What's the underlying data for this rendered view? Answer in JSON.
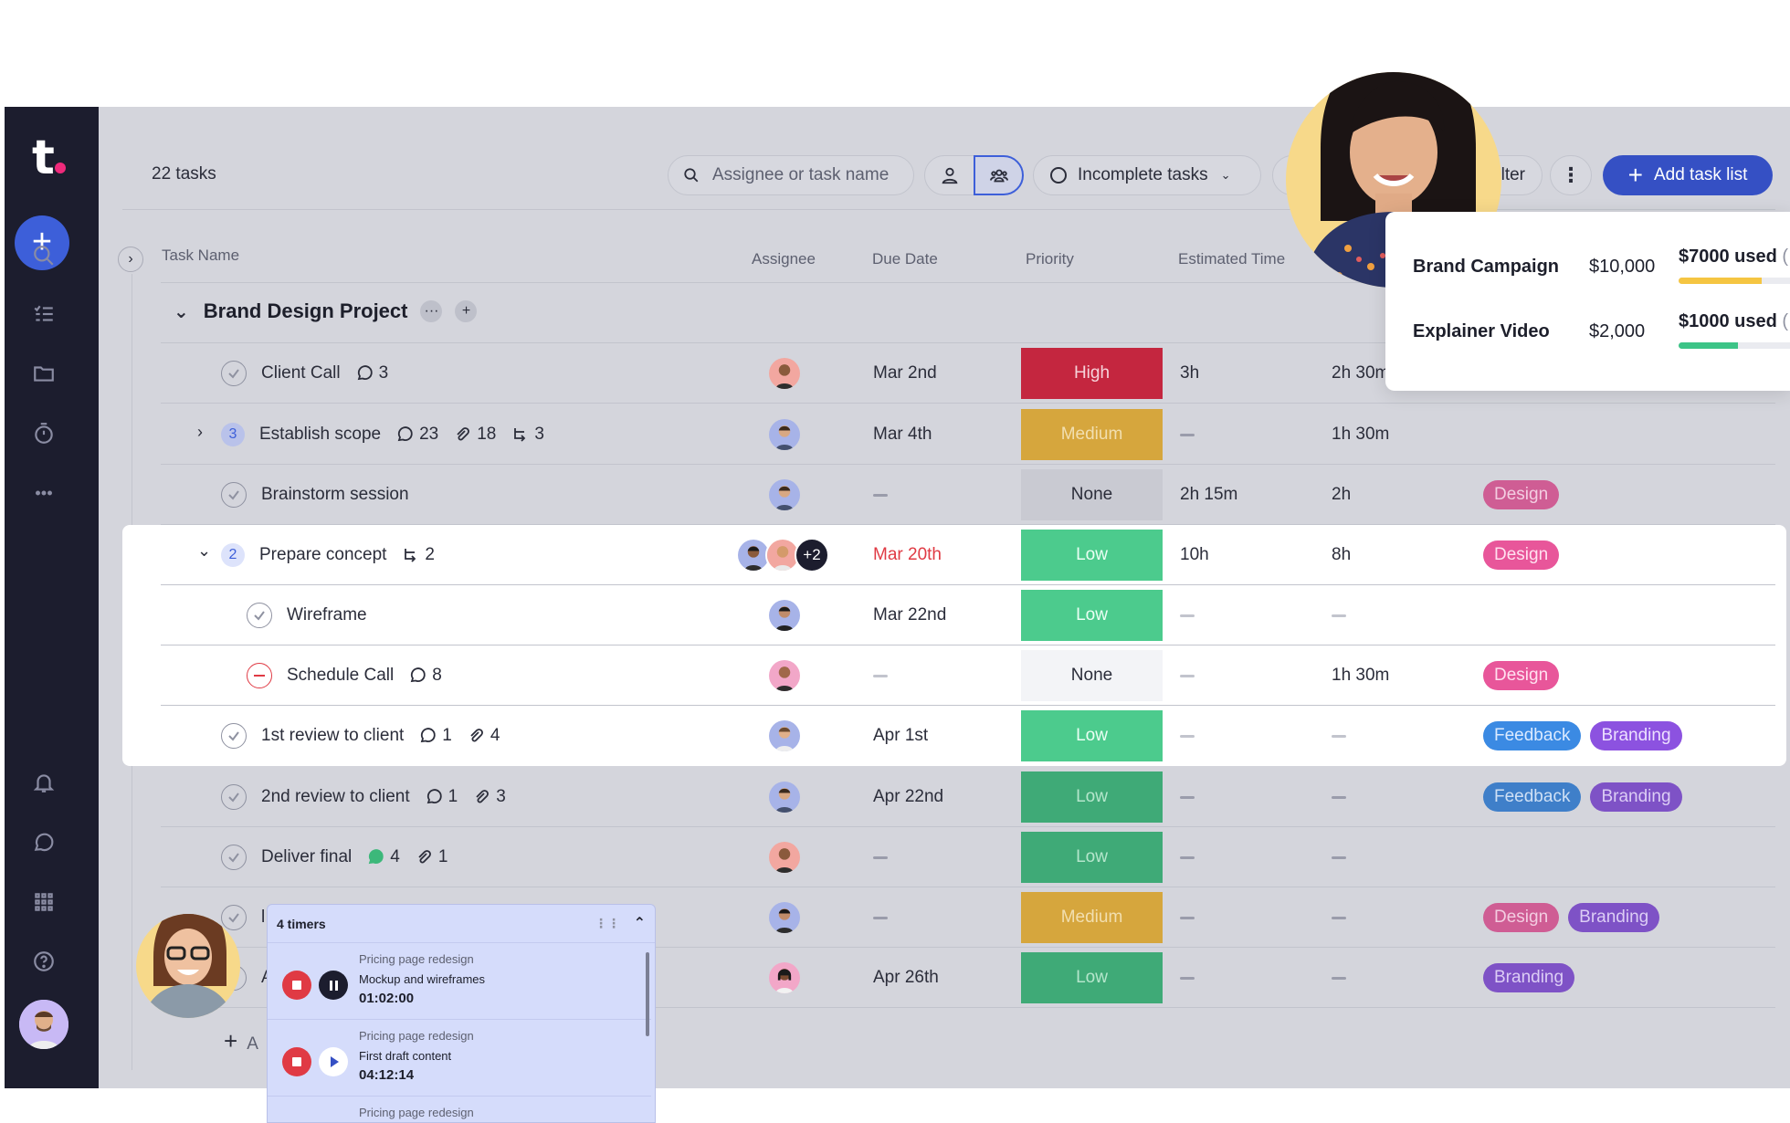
{
  "app": {
    "logo_letter": "t"
  },
  "header": {
    "tasks_count": "22 tasks",
    "search_placeholder": "Assignee or task name",
    "filter_select": "Incomplete tasks",
    "filter_label": "lter",
    "add_task_list": "Add task list"
  },
  "columns": {
    "task_name": "Task Name",
    "assignee": "Assignee",
    "due_date": "Due Date",
    "priority": "Priority",
    "estimated_time": "Estimated Time"
  },
  "group": {
    "title": "Brand Design Project"
  },
  "rows": [
    {
      "name": "Client Call",
      "comments": "3",
      "due": "Mar 2nd",
      "priority": "High",
      "est": "3h",
      "time": "2h 30m"
    },
    {
      "name": "Establish scope",
      "subtasks_count": "3",
      "comments": "23",
      "attachments": "18",
      "subs": "3",
      "due": "Mar 4th",
      "priority": "Medium",
      "time": "1h 30m"
    },
    {
      "name": "Brainstorm session",
      "priority": "None",
      "est": "2h 15m",
      "time": "2h",
      "tags": [
        "Design"
      ]
    },
    {
      "name": "Prepare concept",
      "subtasks_count": "2",
      "subs": "2",
      "extra_assignees": "+2",
      "due": "Mar 20th",
      "priority": "Low",
      "est": "10h",
      "time": "8h",
      "tags": [
        "Design"
      ]
    },
    {
      "name": "Wireframe",
      "due": "Mar 22nd",
      "priority": "Low"
    },
    {
      "name": "Schedule Call",
      "comments": "8",
      "priority": "None",
      "time": "1h 30m",
      "tags": [
        "Design"
      ]
    },
    {
      "name": "1st review to client",
      "comments": "1",
      "attachments": "4",
      "due": "Apr 1st",
      "priority": "Low",
      "tags": [
        "Feedback",
        "Branding"
      ]
    },
    {
      "name": "2nd review to client",
      "comments": "1",
      "attachments": "3",
      "due": "Apr 22nd",
      "priority": "Low",
      "tags": [
        "Feedback",
        "Branding"
      ]
    },
    {
      "name": "Deliver final",
      "comments": "4",
      "attachments": "1",
      "priority": "Low"
    },
    {
      "name": "l",
      "priority": "Medium",
      "tags": [
        "Design",
        "Branding"
      ]
    },
    {
      "name": "A",
      "due": "Apr 26th",
      "priority": "Low",
      "tags": [
        "Branding"
      ]
    }
  ],
  "add_task": {
    "label": "A"
  },
  "budget": [
    {
      "name": "Brand Campaign",
      "amount": "$10,000",
      "used": "$7000 used",
      "used_suffix": "(",
      "fraction": 0.7,
      "color": "#f5c542"
    },
    {
      "name": "Explainer Video",
      "amount": "$2,000",
      "used": "$1000 used",
      "used_suffix": "(",
      "fraction": 0.5,
      "color": "#3cc487"
    }
  ],
  "timers": {
    "title": "4 timers",
    "items": [
      {
        "project": "Pricing page redesign",
        "task": "Mockup and wireframes",
        "time": "01:02:00",
        "state": "running"
      },
      {
        "project": "Pricing page redesign",
        "task": "First draft content",
        "time": "04:12:14",
        "state": "paused"
      },
      {
        "project": "Pricing page redesign"
      }
    ]
  },
  "colors": {
    "accent": "#3550c4",
    "high": "#c4263f",
    "medium": "#d6a63d",
    "low": "#4ccb8d",
    "design": "#e8569a",
    "feedback": "#3b8ae3",
    "branding": "#8c52e0"
  }
}
